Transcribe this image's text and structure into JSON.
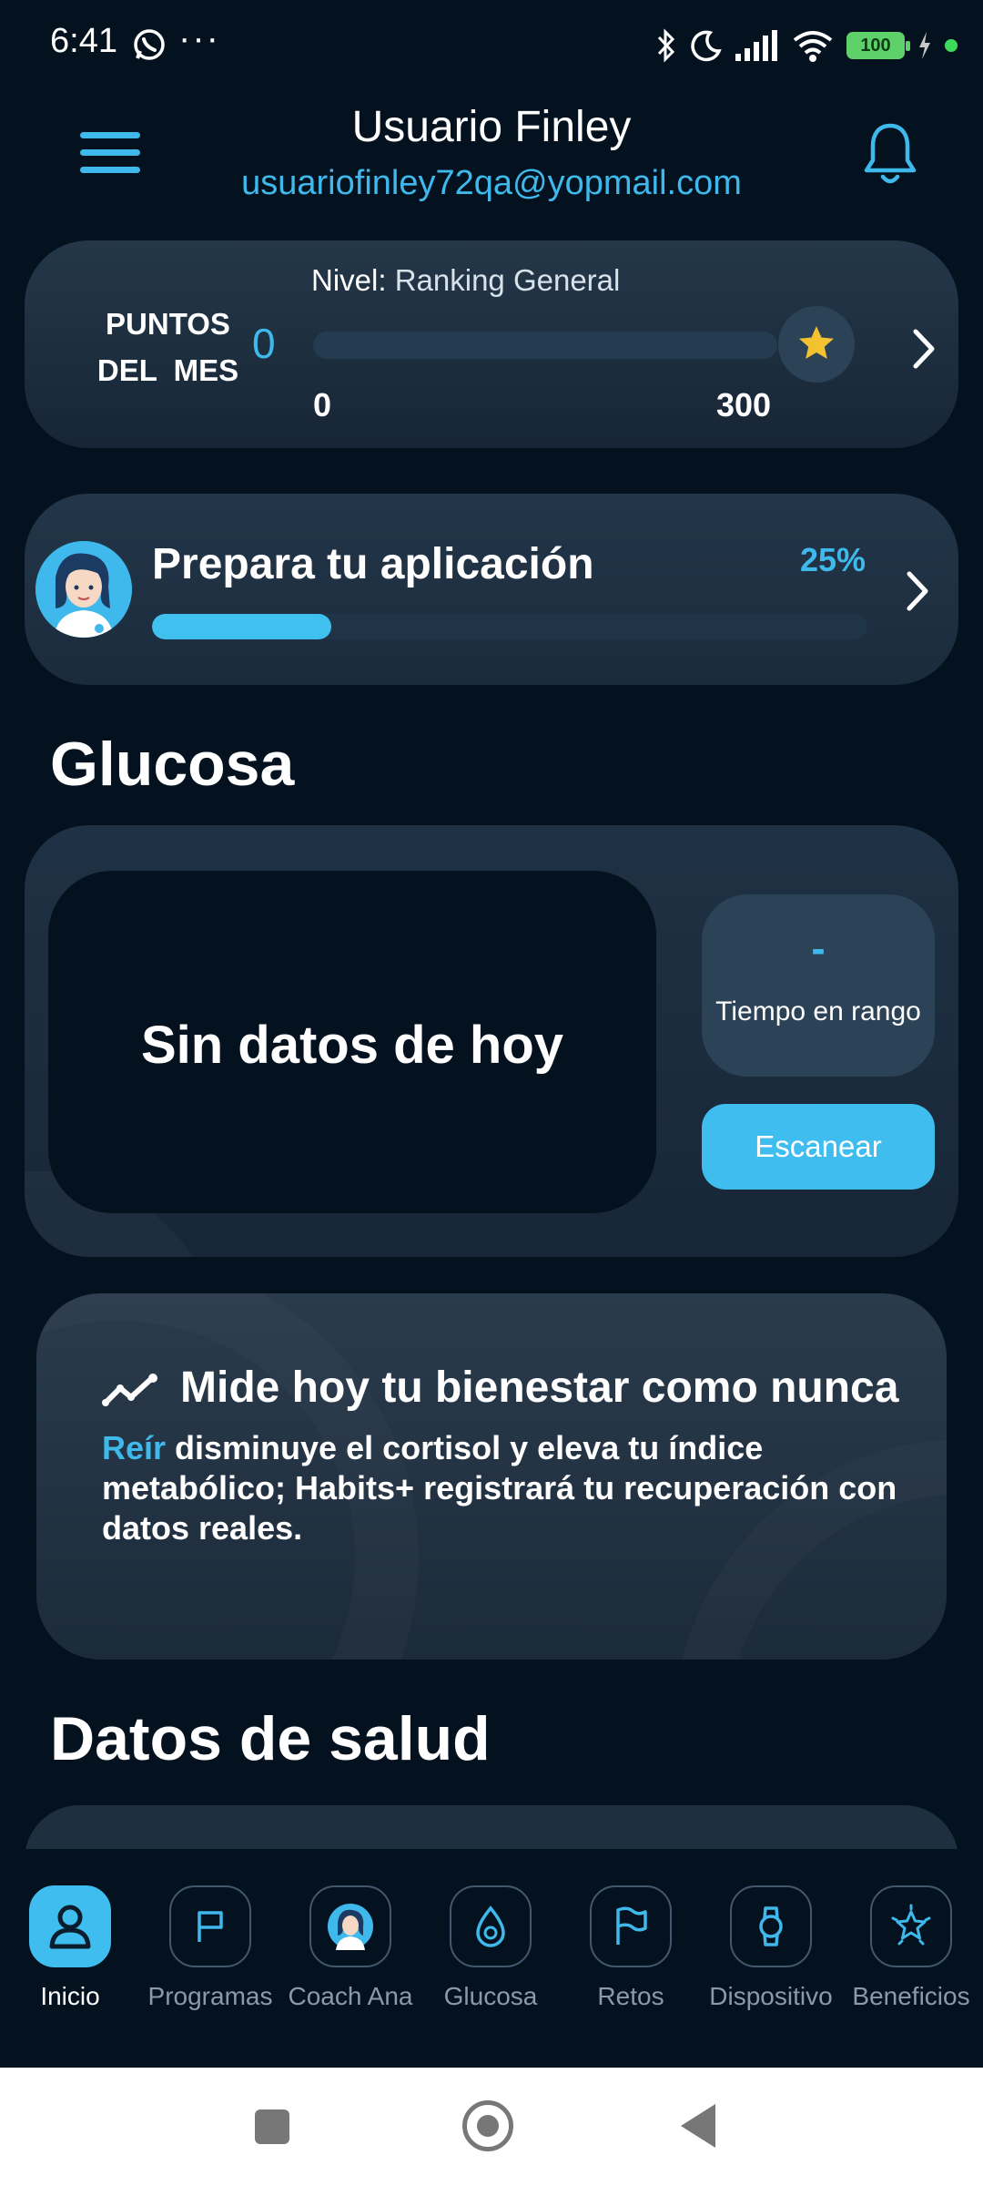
{
  "status_bar": {
    "time": "6:41",
    "more": "···",
    "battery": "100"
  },
  "header": {
    "user_name": "Usuario Finley",
    "email": "usuariofinley72qa@yopmail.com"
  },
  "points": {
    "label_line1": "PUNTOS",
    "label_line2": "DEL  MES",
    "value": "0",
    "level_prefix": "Nivel:",
    "level_name": "Ranking General",
    "min": "0",
    "max": "300",
    "progress_fraction": 0
  },
  "setup": {
    "title": "Prepara tu aplicación",
    "percent": "25%",
    "progress_fraction": 0.25
  },
  "glucose": {
    "section_title": "Glucosa",
    "no_data": "Sin datos de hoy",
    "time_in_range_value": "-",
    "time_in_range_label": "Tiempo en rango",
    "scan_label": "Escanear"
  },
  "wellness": {
    "title": "Mide hoy tu bienestar como nunca",
    "highlight": "Reír",
    "text": " disminuye el cortisol y eleva tu índice metabólico; Habits+ registrará tu recuperación con datos reales."
  },
  "health_data": {
    "section_title": "Datos de salud"
  },
  "nav": {
    "items": [
      {
        "label": "Inicio",
        "icon": "user-icon",
        "active": true
      },
      {
        "label": "Programas",
        "icon": "flag-icon"
      },
      {
        "label": "Coach Ana",
        "icon": "coach-avatar-icon"
      },
      {
        "label": "Glucosa",
        "icon": "drop-icon"
      },
      {
        "label": "Retos",
        "icon": "flag-icon"
      },
      {
        "label": "Dispositivo",
        "icon": "watch-icon"
      },
      {
        "label": "Beneficios",
        "icon": "star-badge-icon"
      }
    ]
  },
  "colors": {
    "accent": "#3fb8ec",
    "background": "#04121f",
    "card": "#1f3144"
  }
}
